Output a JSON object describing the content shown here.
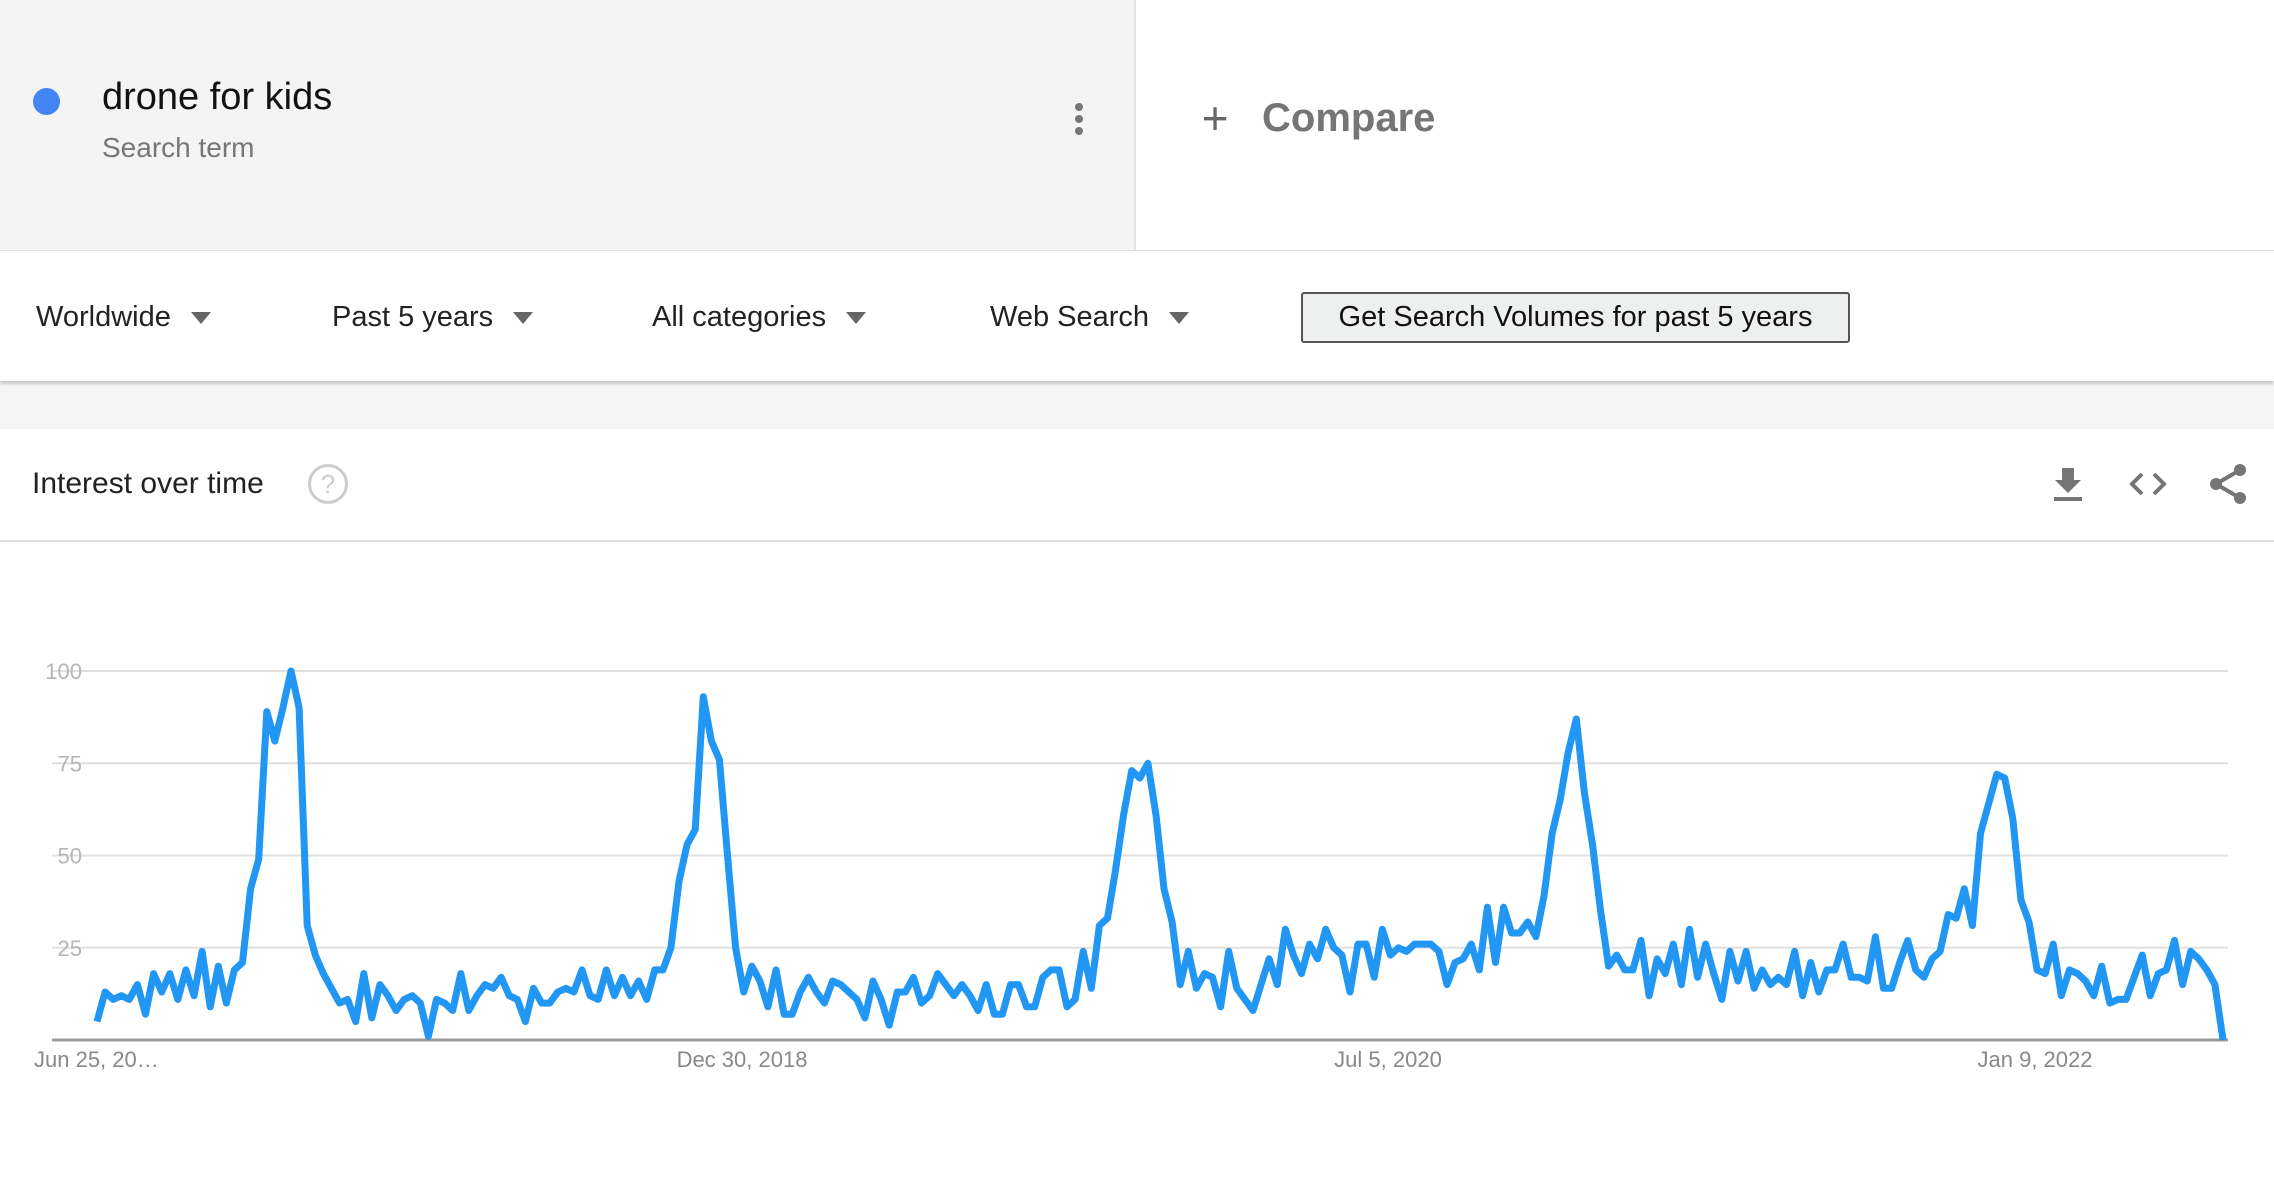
{
  "term": {
    "label": "drone for kids",
    "sublabel": "Search term",
    "color": "#4285f4",
    "menu_icon": "more-vert-icon"
  },
  "compare": {
    "icon": "plus-icon",
    "label": "Compare"
  },
  "filters": {
    "region": "Worldwide",
    "time_range": "Past 5 years",
    "category": "All categories",
    "search_type": "Web Search",
    "volume_button": "Get Search Volumes for past 5 years"
  },
  "card": {
    "title": "Interest over time",
    "help_icon": "?",
    "actions": [
      "download-icon",
      "embed-code-icon",
      "share-icon"
    ]
  },
  "chart_data": {
    "type": "line",
    "title": "",
    "xlabel": "",
    "ylabel": "",
    "ylim": [
      0,
      100
    ],
    "yticks": [
      "25",
      "50",
      "75",
      "100"
    ],
    "xticks": [
      "Jun 25, 20…",
      "Dec 30, 2018",
      "Jul 5, 2020",
      "Jan 9, 2022"
    ],
    "grid": true,
    "line_color": "#2196f3",
    "series": [
      {
        "values": [
          5,
          13,
          11,
          12,
          11,
          15,
          7,
          18,
          13,
          18,
          11,
          19,
          12,
          24,
          9,
          20,
          10,
          19,
          21,
          41,
          49,
          89,
          81,
          90,
          100,
          90,
          31,
          23,
          18,
          14,
          10,
          11,
          5,
          18,
          6,
          15,
          12,
          8,
          11,
          12,
          10,
          1,
          11,
          10,
          8,
          18,
          8,
          12,
          15,
          14,
          17,
          12,
          11,
          5,
          14,
          10,
          10,
          13,
          14,
          13,
          19,
          12,
          11,
          19,
          12,
          17,
          12,
          16,
          11,
          19,
          19,
          25,
          43,
          53,
          57,
          93,
          81,
          76,
          50,
          25,
          13,
          20,
          16,
          9,
          19,
          7,
          7,
          13,
          17,
          13,
          10,
          16,
          15,
          13,
          11,
          6,
          16,
          11,
          4,
          13,
          13,
          17,
          10,
          12,
          18,
          15,
          12,
          15,
          12,
          8,
          15,
          7,
          7,
          15,
          15,
          9,
          9,
          17,
          19,
          19,
          9,
          11,
          24,
          14,
          31,
          33,
          46,
          61,
          73,
          71,
          75,
          61,
          41,
          32,
          15,
          24,
          14,
          18,
          17,
          9,
          24,
          14,
          11,
          8,
          15,
          22,
          15,
          30,
          23,
          18,
          26,
          22,
          30,
          25,
          23,
          13,
          26,
          26,
          17,
          30,
          23,
          25,
          24,
          26,
          26,
          26,
          24,
          15,
          21,
          22,
          26,
          19,
          36,
          21,
          36,
          29,
          29,
          32,
          28,
          39,
          56,
          65,
          78,
          87,
          67,
          53,
          35,
          20,
          23,
          19,
          19,
          27,
          12,
          22,
          18,
          26,
          15,
          30,
          17,
          26,
          18,
          11,
          24,
          16,
          24,
          14,
          19,
          15,
          17,
          15,
          24,
          12,
          21,
          13,
          19,
          19,
          26,
          17,
          17,
          16,
          28,
          14,
          14,
          21,
          27,
          19,
          17,
          22,
          24,
          34,
          33,
          41,
          31,
          56,
          64,
          72,
          71,
          60,
          38,
          32,
          19,
          18,
          26,
          12,
          19,
          18,
          16,
          12,
          20,
          10,
          11,
          11,
          17,
          23,
          12,
          18,
          19,
          27,
          15,
          24,
          22,
          19,
          15,
          0
        ]
      }
    ]
  }
}
